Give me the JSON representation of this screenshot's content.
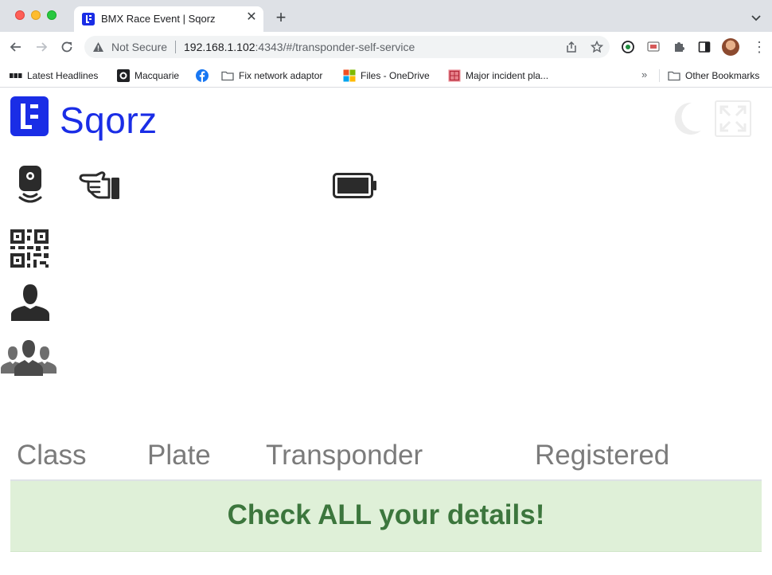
{
  "browser": {
    "tab_title": "BMX Race Event | Sqorz",
    "security_label": "Not Secure",
    "url_host": "192.168.1.102",
    "url_rest": ":4343/#/transponder-self-service",
    "bookmarks": [
      {
        "label": "Latest Headlines",
        "icon": "bbc-icon"
      },
      {
        "label": "Macquarie",
        "icon": "macquarie-icon"
      },
      {
        "label": "",
        "icon": "facebook-icon"
      },
      {
        "label": "Fix network adaptor",
        "icon": "folder-icon"
      },
      {
        "label": "Files - OneDrive",
        "icon": "microsoft-icon"
      },
      {
        "label": "Major incident pla...",
        "icon": "page-icon"
      }
    ],
    "other_bookmarks": "Other Bookmarks"
  },
  "app": {
    "brand": "Sqorz",
    "colors": {
      "brand": "#1a2de6",
      "alert_bg": "#dff0d8",
      "alert_text": "#3c763d",
      "header_text": "#7b7b7b"
    }
  },
  "table": {
    "headers": [
      "Class",
      "Plate",
      "Transponder",
      "Registered"
    ]
  },
  "alert": {
    "message": "Check ALL your details!"
  }
}
